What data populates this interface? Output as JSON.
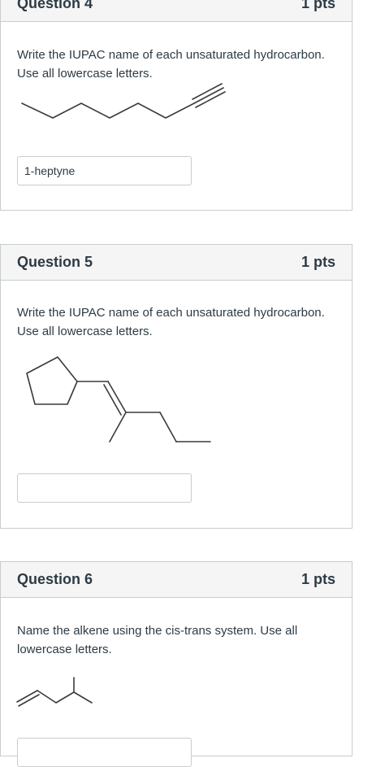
{
  "questions": [
    {
      "title": "Question 4",
      "points": "1 pts",
      "prompt": "Write the IUPAC name of each unsaturated hydrocarbon. Use all lowercase letters.",
      "answer_value": "1-heptyne"
    },
    {
      "title": "Question 5",
      "points": "1 pts",
      "prompt": "Write the IUPAC name of each unsaturated hydrocarbon. Use all lowercase letters.",
      "answer_value": ""
    },
    {
      "title": "Question 6",
      "points": "1 pts",
      "prompt": "Name the alkene using the cis-trans system. Use all lowercase letters.",
      "answer_value": ""
    }
  ]
}
